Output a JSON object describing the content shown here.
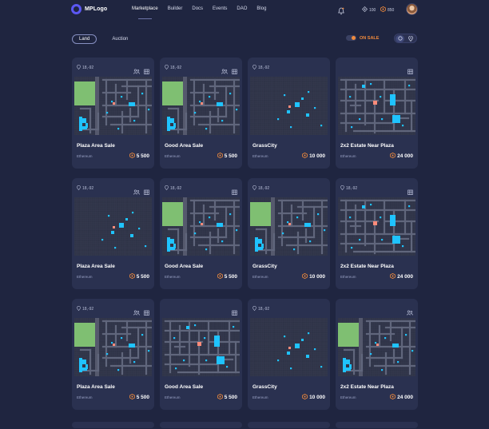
{
  "header": {
    "logo_text": "MPLogo",
    "nav": [
      "Marketplace",
      "Builder",
      "Docs",
      "Events",
      "DAO",
      "Blog"
    ],
    "active_nav": "Marketplace",
    "stats": [
      {
        "icon": "pin-icon",
        "value": "100"
      },
      {
        "icon": "coin-icon",
        "value": "850"
      }
    ]
  },
  "filters": {
    "tabs": [
      "Land",
      "Auction"
    ],
    "active_tab": "Land",
    "on_sale_label": "ON SALE",
    "on_sale_enabled": true
  },
  "colors": {
    "background": "#1f2540",
    "card": "#2a3150",
    "accent_orange": "#f08a3c",
    "water": "#1fc3ff",
    "grass": "#7fbf72",
    "road": "#5b6078"
  },
  "cards": [
    {
      "coord": "18,-92",
      "title": "Plaza Area Sale",
      "chain": "Ethereum",
      "price": "5 500",
      "icons": [
        "person-icon",
        "building-icon"
      ],
      "map": "A"
    },
    {
      "coord": "18,-92",
      "title": "Good Area Sale",
      "chain": "Ethereum",
      "price": "5 500",
      "icons": [
        "person-icon",
        "building-icon"
      ],
      "map": "A"
    },
    {
      "coord": "18,-92",
      "title": "GrassCity",
      "chain": "Ethereum",
      "price": "10 000",
      "icons": [],
      "map": "B"
    },
    {
      "coord": "",
      "title": "2x2 Estate Near Plaza",
      "chain": "Ethereum",
      "price": "24 000",
      "icons": [
        "building-icon"
      ],
      "map": "C"
    },
    {
      "coord": "18,-92",
      "title": "Plaza Area Sale",
      "chain": "Ethereum",
      "price": "5 500",
      "icons": [
        "person-icon",
        "building-icon"
      ],
      "map": "B"
    },
    {
      "coord": "18,-92",
      "title": "Good Area Sale",
      "chain": "Ethereum",
      "price": "5 500",
      "icons": [
        "building-icon"
      ],
      "map": "A"
    },
    {
      "coord": "18,-92",
      "title": "GrassCity",
      "chain": "Ethereum",
      "price": "10 000",
      "icons": [],
      "map": "A"
    },
    {
      "coord": "18,-92",
      "title": "2x2 Estate Near Plaza",
      "chain": "Ethereum",
      "price": "24 000",
      "icons": [
        "building-icon"
      ],
      "map": "C"
    },
    {
      "coord": "18,-92",
      "title": "Plaza Area Sale",
      "chain": "Ethereum",
      "price": "5 500",
      "icons": [
        "person-icon",
        "building-icon"
      ],
      "map": "A"
    },
    {
      "coord": "",
      "title": "Good Area Sale",
      "chain": "Ethereum",
      "price": "5 500",
      "icons": [
        "building-icon"
      ],
      "map": "C"
    },
    {
      "coord": "18,-92",
      "title": "GrassCity",
      "chain": "Ethereum",
      "price": "10 000",
      "icons": [],
      "map": "B"
    },
    {
      "coord": "",
      "title": "2x2 Estate Near Plaza",
      "chain": "Ethereum",
      "price": "24 000",
      "icons": [
        "person-icon"
      ],
      "map": "A"
    }
  ]
}
